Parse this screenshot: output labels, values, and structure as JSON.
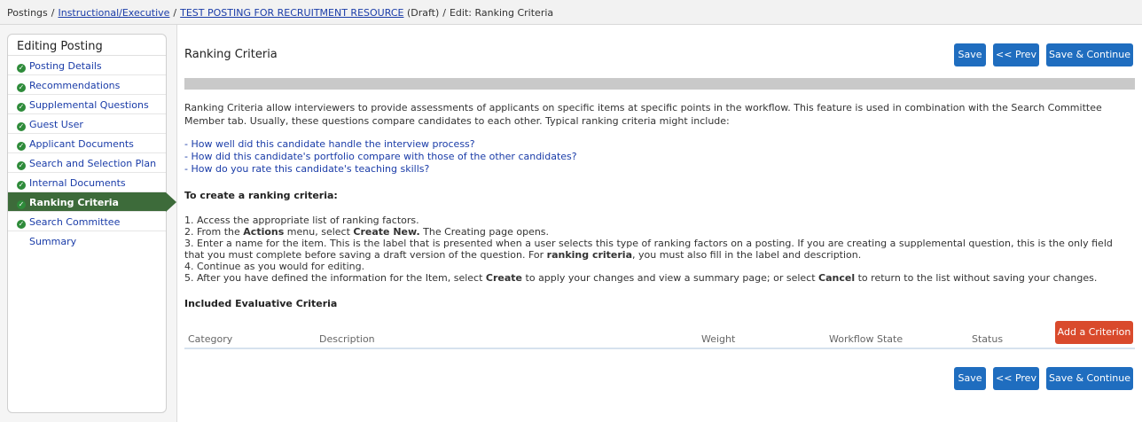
{
  "breadcrumb": {
    "root": "Postings",
    "category": "Instructional/Executive",
    "posting": "TEST POSTING FOR RECRUITMENT RESOURCE",
    "status": "(Draft)",
    "current": "Edit: Ranking Criteria",
    "separator": "/"
  },
  "sidebar": {
    "title": "Editing Posting",
    "items": [
      {
        "label": "Posting Details",
        "icon": "check-circle-icon"
      },
      {
        "label": "Recommendations",
        "icon": "check-circle-icon"
      },
      {
        "label": "Supplemental Questions",
        "icon": "check-circle-icon"
      },
      {
        "label": "Guest User",
        "icon": "check-circle-icon"
      },
      {
        "label": "Applicant Documents",
        "icon": "check-circle-icon"
      },
      {
        "label": "Search and Selection Plan",
        "icon": "check-circle-icon"
      },
      {
        "label": "Internal Documents",
        "icon": "check-circle-icon"
      },
      {
        "label": "Ranking Criteria",
        "icon": "check-circle-icon",
        "active": true
      },
      {
        "label": "Search Committee",
        "icon": "check-circle-icon"
      },
      {
        "label": "Summary"
      }
    ]
  },
  "main": {
    "title": "Ranking Criteria",
    "buttons": {
      "save": "Save",
      "prev": "<< Prev",
      "save_continue": "Save & Continue"
    },
    "intro": "Ranking Criteria allow interviewers to provide assessments of applicants on specific items at specific points in the workflow. This feature is used in combination with the Search Committee Member tab. Usually, these questions compare candidates to each other. Typical ranking criteria might include:",
    "examples": [
      "- How well did this candidate handle the interview process?",
      "- How did this candidate's portfolio compare with those of the other candidates?",
      "- How do you rate this candidate's teaching skills?"
    ],
    "howto_heading": "To create a ranking criteria:",
    "steps": {
      "s1": "1. Access the appropriate list of ranking factors.",
      "s2_a": "2. From the ",
      "s2_b": "Actions",
      "s2_c": " menu, select ",
      "s2_d": "Create New.",
      "s2_e": " The Creating page opens.",
      "s3_a": "3. Enter a name for the item. This is the label that is presented when a user selects this type of ranking factors on a posting. If you are creating a supplemental question, this is the only field that you must complete before saving a draft version of the question. For ",
      "s3_b": "ranking criteria",
      "s3_c": ", you must also fill in the label and description.",
      "s4": "4. Continue as you would for editing.",
      "s5_a": "5. After you have defined the information for the Item, select ",
      "s5_b": "Create",
      "s5_c": " to apply your changes and view a summary page; or select ",
      "s5_d": "Cancel",
      "s5_e": " to return to the list without saving your changes."
    },
    "included_heading": "Included Evaluative Criteria",
    "add_button": "Add a Criterion",
    "table_columns": [
      "Category",
      "Description",
      "Weight",
      "Workflow State",
      "Status"
    ]
  },
  "colors": {
    "primary_button": "#1f6dbf",
    "danger_button": "#d94a2c",
    "active_nav": "#3d6b3a",
    "check_icon": "#2e8b3a",
    "link": "#1a3ca8"
  }
}
